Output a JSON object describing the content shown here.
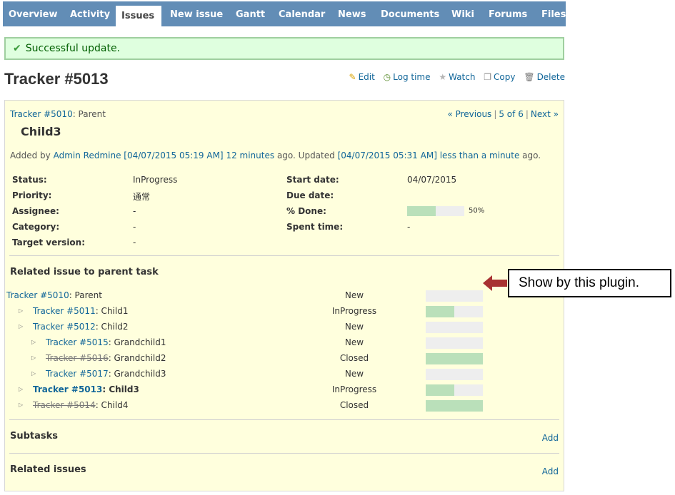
{
  "tabs": [
    {
      "label": "Overview"
    },
    {
      "label": "Activity"
    },
    {
      "label": "Issues"
    },
    {
      "label": "New issue"
    },
    {
      "label": "Gantt"
    },
    {
      "label": "Calendar"
    },
    {
      "label": "News"
    },
    {
      "label": "Documents"
    },
    {
      "label": "Wiki"
    },
    {
      "label": "Forums"
    },
    {
      "label": "Files"
    }
  ],
  "flash": {
    "message": "Successful update."
  },
  "title": "Tracker #5013",
  "actions": {
    "edit": "Edit",
    "log_time": "Log time",
    "watch": "Watch",
    "copy": "Copy",
    "delete": "Delete"
  },
  "issue": {
    "parent_link": "Tracker #5010",
    "parent_subject": ": Parent",
    "nav": {
      "previous": "« Previous",
      "position": "5 of 6",
      "next": "Next »"
    },
    "subject": "Child3",
    "author": {
      "added_by": "Added by",
      "author_name": "Admin Redmine",
      "created_at": "[04/07/2015 05:19 AM]",
      "created_ago": "12 minutes",
      "ago_updated": "ago. Updated",
      "updated_at": "[04/07/2015 05:31 AM]",
      "updated_ago": "less than a minute",
      "ago": "ago."
    },
    "attributes": {
      "status_label": "Status:",
      "status": "InProgress",
      "priority_label": "Priority:",
      "priority": "通常",
      "assignee_label": "Assignee:",
      "assignee": "-",
      "category_label": "Category:",
      "category": "-",
      "target_version_label": "Target version:",
      "target_version": "-",
      "start_date_label": "Start date:",
      "start_date": "04/07/2015",
      "due_date_label": "Due date:",
      "due_date": "",
      "done_label": "% Done:",
      "done_ratio": 50,
      "done_text": "50%",
      "spent_time_label": "Spent time:",
      "spent_time": "-"
    }
  },
  "related_section": {
    "title": "Related issue to parent task",
    "rows": [
      {
        "link": "Tracker #5010",
        "subject": ": Parent",
        "status": "New",
        "done": 0,
        "level": 0,
        "arrow": false,
        "closed": false,
        "current": false
      },
      {
        "link": "Tracker #5011",
        "subject": ": Child1",
        "status": "InProgress",
        "done": 50,
        "level": 1,
        "arrow": true,
        "closed": false,
        "current": false
      },
      {
        "link": "Tracker #5012",
        "subject": ": Child2",
        "status": "New",
        "done": 0,
        "level": 1,
        "arrow": true,
        "closed": false,
        "current": false
      },
      {
        "link": "Tracker #5015",
        "subject": ": Grandchild1",
        "status": "New",
        "done": 0,
        "level": 2,
        "arrow": true,
        "closed": false,
        "current": false
      },
      {
        "link": "Tracker #5016",
        "subject": ": Grandchild2",
        "status": "Closed",
        "done": 100,
        "level": 2,
        "arrow": true,
        "closed": true,
        "current": false
      },
      {
        "link": "Tracker #5017",
        "subject": ": Grandchild3",
        "status": "New",
        "done": 0,
        "level": 2,
        "arrow": true,
        "closed": false,
        "current": false
      },
      {
        "link": "Tracker #5013",
        "subject": ": Child3",
        "status": "InProgress",
        "done": 50,
        "level": 1,
        "arrow": true,
        "closed": false,
        "current": true
      },
      {
        "link": "Tracker #5014",
        "subject": ": Child4",
        "status": "Closed",
        "done": 100,
        "level": 1,
        "arrow": true,
        "closed": true,
        "current": false
      }
    ]
  },
  "subtasks": {
    "title": "Subtasks",
    "add": "Add"
  },
  "related_issues": {
    "title": "Related issues",
    "add": "Add"
  },
  "annotation": {
    "text": "Show by this plugin.",
    "arrow_color": "#a83232"
  },
  "colors": {
    "tab_bar": "#628db6",
    "link": "#116699",
    "issue_bg": "#ffffdd",
    "flash_bg": "#dfffdf",
    "progress_done": "#bae0ba",
    "progress_todo": "#eeeeee"
  }
}
